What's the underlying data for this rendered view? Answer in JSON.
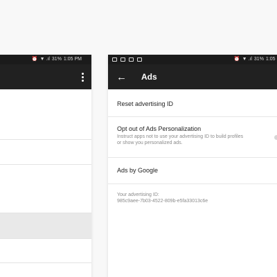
{
  "left_phone": {
    "status": {
      "alarm": "⏰",
      "signal": "▼ .ıl",
      "battery": "31%",
      "time": "1:05 PM"
    }
  },
  "right_phone": {
    "status": {
      "alarm": "⏰",
      "signal": "▼ .ıl",
      "battery": "31%",
      "time": "1:05 PM"
    },
    "appbar": {
      "back": "←",
      "title": "Ads"
    },
    "items": {
      "reset": {
        "title": "Reset advertising ID"
      },
      "opt_out": {
        "title": "Opt out of Ads Personalization",
        "subtitle": "Instruct apps not to use your advertising ID to build profiles or show you personalized ads.",
        "toggle_on": false
      },
      "ads_by_google": {
        "title": "Ads by Google"
      },
      "advertising_id": {
        "label": "Your advertising ID:",
        "value": "985c9aee-7b03-4522-809b-e5fa33013c6e"
      }
    }
  }
}
